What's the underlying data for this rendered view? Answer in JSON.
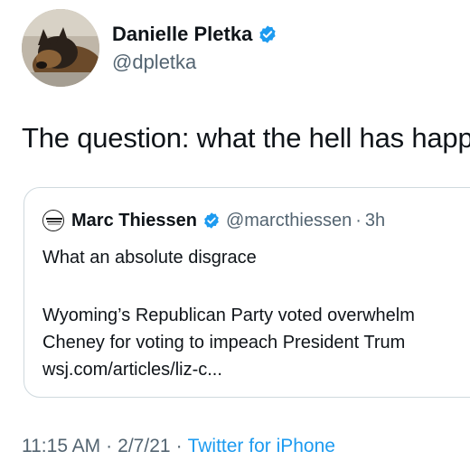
{
  "author": {
    "name": "Danielle Pletka",
    "handle": "@dpletka",
    "verified": true,
    "avatar_icon": "dog-photo-avatar"
  },
  "tweet": {
    "text": "The question: what the hell has happ"
  },
  "quoted_tweet": {
    "name": "Marc Thiessen",
    "handle": "@marcthiessen",
    "separator": "·",
    "time": "3h",
    "verified": true,
    "line1": "What an absolute disgrace",
    "line2": "Wyoming’s Republican Party voted overwhelm",
    "line3": "Cheney for voting to impeach President Trum",
    "line4": "wsj.com/articles/liz-c..."
  },
  "meta": {
    "time": "11:15 AM",
    "sep1": "·",
    "date": "2/7/21",
    "sep2": "·",
    "source": "Twitter for iPhone"
  },
  "colors": {
    "verified_blue": "#1d9bf0",
    "secondary_text": "#536471",
    "link": "#1d9bf0"
  }
}
